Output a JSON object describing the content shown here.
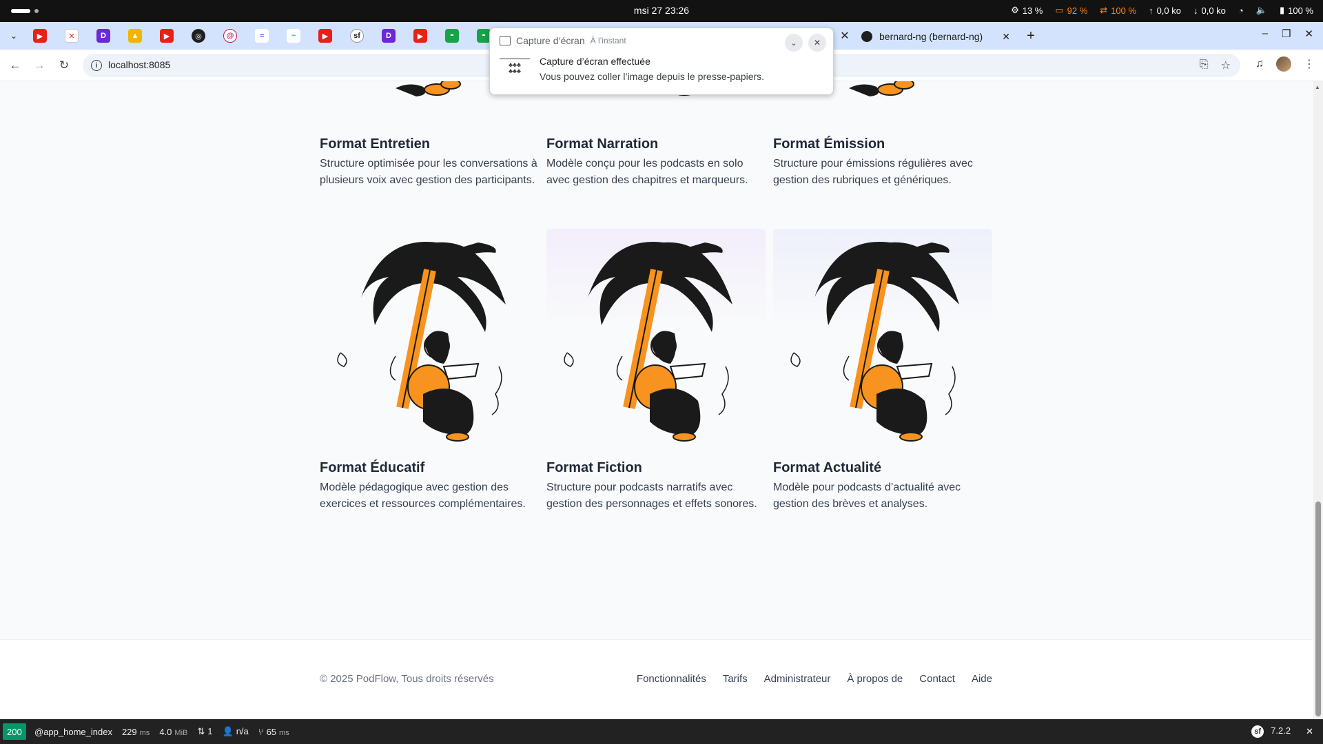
{
  "topbar": {
    "clock": "msi 27  23:26",
    "cpu": "13 %",
    "mem": "92 %",
    "swap": "100 %",
    "upload": "0,0 ko",
    "download": "0,0 ko",
    "battery": "100 %"
  },
  "tabs": {
    "pinned_icons": [
      "youtube-icon",
      "red-x-icon",
      "purple-app-icon",
      "drive-icon",
      "youtube-icon",
      "target-icon",
      "spiral-icon",
      "wave-icon",
      "tailwind-icon",
      "youtube-icon",
      "symfony-icon",
      "purple-app-icon",
      "youtube-icon",
      "android-icon",
      "android-icon"
    ],
    "active_tab_close": "✕",
    "github_tab_title": "bernard-ng (bernard-ng)",
    "new_tab": "+"
  },
  "toolbar": {
    "url": "localhost:8085"
  },
  "notification": {
    "app": "Capture d’écran",
    "time": "À l’instant",
    "title": "Capture d’écran effectuée",
    "body": "Vous pouvez coller l’image depuis le presse-papiers."
  },
  "cards": [
    {
      "title": "Format Entretien",
      "desc": "Structure optimisée pour les conversations à plusieurs voix avec gestion des participants."
    },
    {
      "title": "Format Narration",
      "desc": "Modèle conçu pour les podcasts en solo avec gestion des chapitres et marqueurs."
    },
    {
      "title": "Format Émission",
      "desc": "Structure pour émissions régulières avec gestion des rubriques et génériques."
    },
    {
      "title": "Format Éducatif",
      "desc": "Modèle pédagogique avec gestion des exercices et ressources complémentaires."
    },
    {
      "title": "Format Fiction",
      "desc": "Structure pour podcasts narratifs avec gestion des personnages et effets sonores."
    },
    {
      "title": "Format Actualité",
      "desc": "Modèle pour podcasts d’actualité avec gestion des brèves et analyses."
    }
  ],
  "footer": {
    "copyright": "© 2025 PodFlow, Tous droits réservés",
    "links": [
      "Fonctionnalités",
      "Tarifs",
      "Administrateur",
      "À propos de",
      "Contact",
      "Aide"
    ]
  },
  "debugbar": {
    "status": "200",
    "route": "@app_home_index",
    "time": "229",
    "time_unit": "ms",
    "memory": "4.0",
    "memory_unit": "MiB",
    "requests": "1",
    "user": "n/a",
    "db_time": "65",
    "db_unit": "ms",
    "version": "7.2.2"
  },
  "colors": {
    "accent_status": "#059669",
    "orange": "#f7931e"
  }
}
